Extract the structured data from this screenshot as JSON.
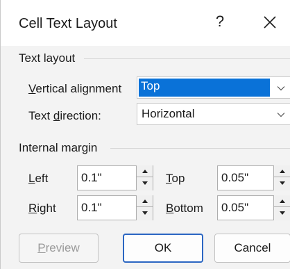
{
  "dialog": {
    "title": "Cell Text Layout",
    "help_label": "?",
    "close_icon": "close-icon"
  },
  "text_layout": {
    "section_label": "Text layout",
    "vertical_alignment": {
      "label_prefix": "",
      "label_accel": "V",
      "label_rest": "ertical alignment",
      "value": "Top",
      "focused": true
    },
    "text_direction": {
      "label_prefix": "Text ",
      "label_accel": "d",
      "label_rest": "irection:",
      "value": "Horizontal"
    }
  },
  "internal_margin": {
    "section_label": "Internal margin",
    "left": {
      "label_accel": "L",
      "label_rest": "eft",
      "value": "0.1\""
    },
    "right": {
      "label_accel": "R",
      "label_rest": "ight",
      "value": "0.1\""
    },
    "top": {
      "label_accel": "T",
      "label_rest": "op",
      "value": "0.05\""
    },
    "bottom": {
      "label_accel": "B",
      "label_rest": "ottom",
      "value": "0.05\""
    }
  },
  "buttons": {
    "preview": {
      "label_accel": "P",
      "label_rest": "review",
      "enabled": false
    },
    "ok": "OK",
    "cancel": "Cancel"
  },
  "colors": {
    "selection": "#0a72d8",
    "primary_border": "#2b66c2",
    "dialog_bg": "#f3f3f3"
  }
}
